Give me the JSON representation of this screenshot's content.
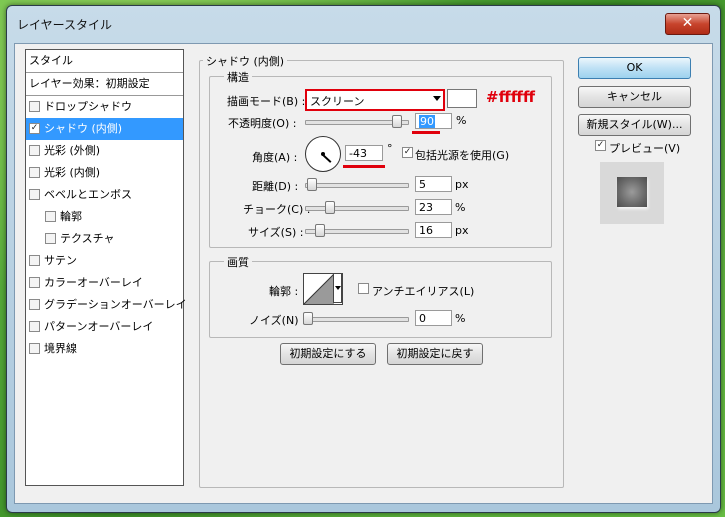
{
  "window": {
    "title": "レイヤースタイル",
    "close_label": "✕"
  },
  "styles_list": {
    "header": "スタイル",
    "blend_default": "レイヤー効果：初期設定",
    "items": [
      {
        "label": "ドロップシャドウ",
        "checked": false
      },
      {
        "label": "シャドウ (内側)",
        "checked": true,
        "selected": true
      },
      {
        "label": "光彩 (外側)",
        "checked": false
      },
      {
        "label": "光彩 (内側)",
        "checked": false
      },
      {
        "label": "ベベルとエンボス",
        "checked": false
      },
      {
        "label": "輪郭",
        "checked": false,
        "indent": true
      },
      {
        "label": "テクスチャ",
        "checked": false,
        "indent": true
      },
      {
        "label": "サテン",
        "checked": false
      },
      {
        "label": "カラーオーバーレイ",
        "checked": false
      },
      {
        "label": "グラデーションオーバーレイ",
        "checked": false
      },
      {
        "label": "パターンオーバーレイ",
        "checked": false
      },
      {
        "label": "境界線",
        "checked": false
      }
    ]
  },
  "inner_shadow": {
    "group_title": "シャドウ (内側)",
    "structure_title": "構造",
    "blend_mode_label": "描画モード(B) :",
    "blend_mode_value": "スクリーン",
    "color_annotation": "#ffffff",
    "opacity_label": "不透明度(O) :",
    "opacity_value": "90",
    "opacity_unit": "%",
    "angle_label": "角度(A) :",
    "angle_value": "-43",
    "angle_unit": "°",
    "global_light_label": "包括光源を使用(G)",
    "global_light_checked": true,
    "distance_label": "距離(D) :",
    "distance_value": "5",
    "distance_unit": "px",
    "choke_label": "チョーク(C) :",
    "choke_value": "23",
    "choke_unit": "%",
    "size_label": "サイズ(S) :",
    "size_value": "16",
    "size_unit": "px"
  },
  "quality": {
    "group_title": "画質",
    "contour_label": "輪郭 :",
    "anti_alias_label": "アンチエイリアス(L)",
    "anti_alias_checked": false,
    "noise_label": "ノイズ(N) :",
    "noise_value": "0",
    "noise_unit": "%"
  },
  "bottom_buttons": {
    "make_default": "初期設定にする",
    "reset_default": "初期設定に戻す"
  },
  "right_buttons": {
    "ok": "OK",
    "cancel": "キャンセル",
    "new_style": "新規スタイル(W)...",
    "preview_label": "プレビュー(V)",
    "preview_checked": true
  },
  "colors": {
    "accent_red": "#e0000c",
    "selection_blue": "#3399ff",
    "shadow_color": "#ffffff"
  }
}
